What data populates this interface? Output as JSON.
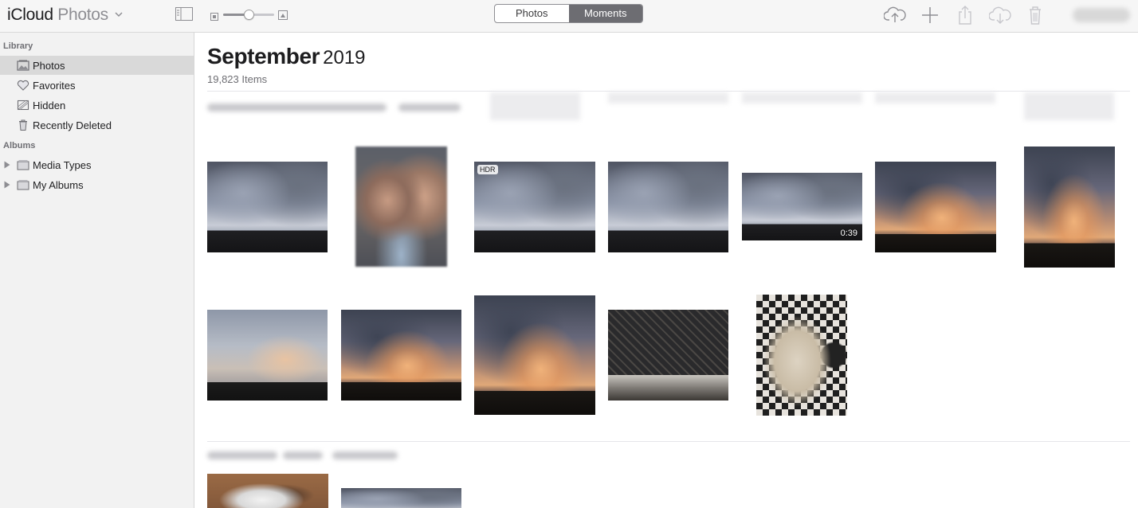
{
  "app": {
    "title_left": "iCloud",
    "title_right": "Photos"
  },
  "view_switch": {
    "items": [
      "Photos",
      "Moments"
    ],
    "active": "Moments"
  },
  "zoom": {
    "level": 0.5
  },
  "toolbar_icons": [
    "upload-cloud-icon",
    "plus-icon",
    "share-icon",
    "download-cloud-icon",
    "trash-icon"
  ],
  "sidebar": {
    "library_title": "Library",
    "library_items": [
      {
        "label": "Photos",
        "icon": "photos-icon",
        "selected": true
      },
      {
        "label": "Favorites",
        "icon": "heart-icon",
        "selected": false
      },
      {
        "label": "Hidden",
        "icon": "hidden-icon",
        "selected": false
      },
      {
        "label": "Recently Deleted",
        "icon": "trash-icon",
        "selected": false
      }
    ],
    "albums_title": "Albums",
    "album_items": [
      {
        "label": "Media Types",
        "icon": "folder-icon"
      },
      {
        "label": "My Albums",
        "icon": "folder-icon"
      }
    ]
  },
  "main": {
    "month": "September",
    "year": "2019",
    "item_count": "19,823 Items",
    "photos": [
      {
        "kind": "sky-gray"
      },
      {
        "kind": "selfie"
      },
      {
        "kind": "sky-gray",
        "badge": "HDR"
      },
      {
        "kind": "sky-gray"
      },
      {
        "kind": "sky-gray",
        "duration": "0:39"
      },
      {
        "kind": "sky-sunset"
      },
      {
        "kind": "sky-sunset"
      },
      {
        "kind": "sky-light"
      },
      {
        "kind": "sky-sunset"
      },
      {
        "kind": "sky-sunset"
      },
      {
        "kind": "kitchen"
      },
      {
        "kind": "cake"
      },
      {
        "kind": "dog"
      },
      {
        "kind": "sky-gray"
      }
    ]
  },
  "colors": {
    "selected_bg": "#d9d9d9",
    "segment_active": "#6d6d72",
    "sidebar_bg": "#f2f2f2"
  }
}
